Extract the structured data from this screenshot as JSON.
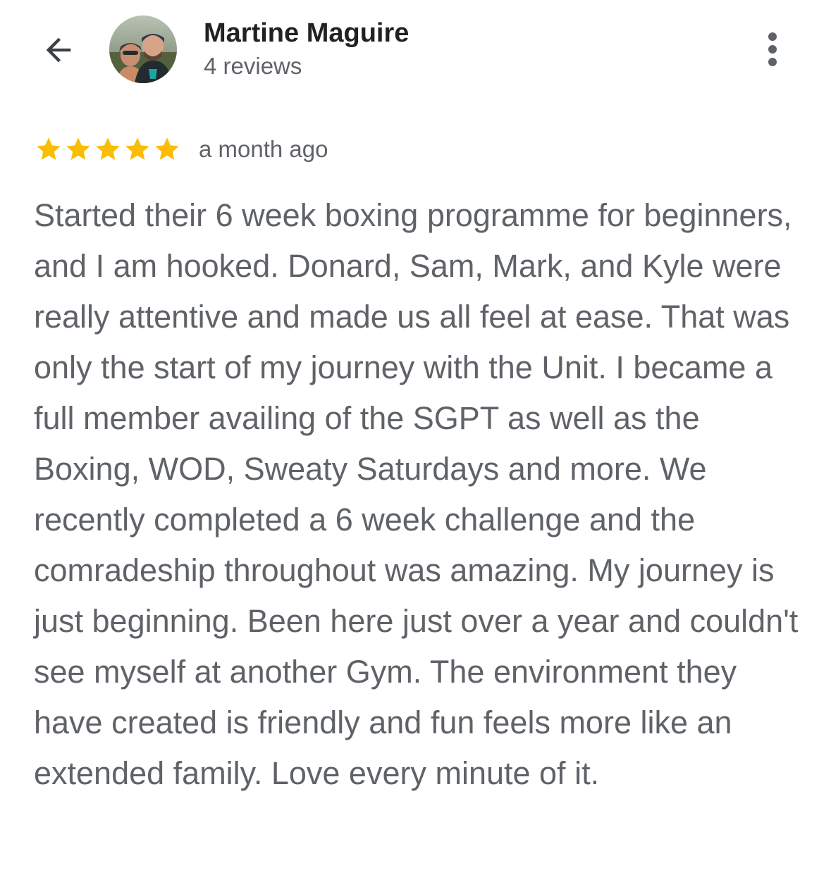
{
  "header": {
    "back_icon": "arrow-left-icon",
    "reviewer_name": "Martine Maguire",
    "review_count": "4 reviews",
    "more_icon": "more-vert-icon"
  },
  "review": {
    "rating": 5,
    "max_rating": 5,
    "star_color": "#fbbc04",
    "date": "a month ago",
    "text": "Started their 6 week boxing programme for beginners, and I am hooked. Donard, Sam, Mark, and Kyle were really attentive and made us all feel at ease. That was only the start of my journey with the Unit. I became a full member availing of the SGPT as well as the Boxing, WOD, Sweaty Saturdays and more. We recently completed a 6 week challenge and the comradeship throughout was amazing. My journey is just beginning. Been here just over a year and couldn't see myself at another Gym. The environment they have created is friendly and fun feels more like an extended family. Love every minute of it."
  },
  "colors": {
    "name": "#202124",
    "secondary_text": "#5f6368",
    "icon": "#5f6368"
  }
}
